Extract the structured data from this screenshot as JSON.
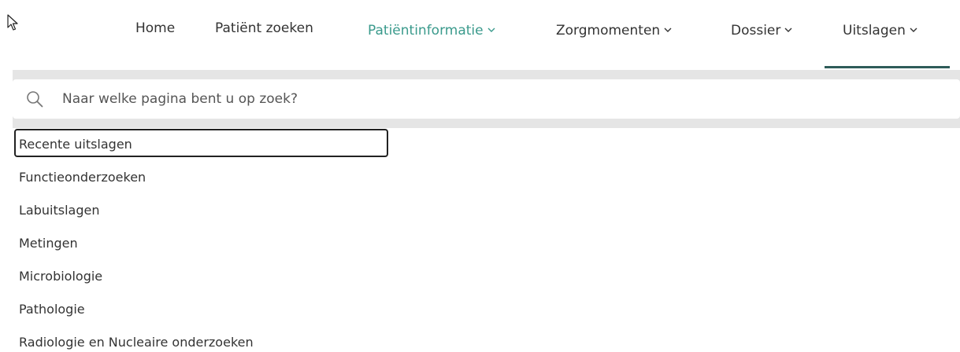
{
  "nav": {
    "items": [
      {
        "label": "Home",
        "chevron": ""
      },
      {
        "label": "Patiënt zoeken",
        "chevron": ""
      },
      {
        "label": "Patiëntinformatie",
        "chevron": "⌄",
        "highlight": true
      },
      {
        "label": "Zorgmomenten",
        "chevron": "⌄"
      },
      {
        "label": "Dossier",
        "chevron": "⌄"
      },
      {
        "label": "Uitslagen",
        "chevron": "⌄",
        "active": true
      }
    ]
  },
  "search": {
    "placeholder": "Naar welke pagina bent u op zoek?",
    "value": ""
  },
  "results": {
    "focused_index": 0,
    "items": [
      "Recente uitslagen",
      "Functieonderzoeken",
      "Labuitslagen",
      "Metingen",
      "Microbiologie",
      "Pathologie",
      "Radiologie en Nucleaire onderzoeken"
    ]
  },
  "colors": {
    "highlight": "#3a9a8c",
    "active_underline": "#2e5c59",
    "panel": "#e5e5e5"
  },
  "icons": {
    "cursor": "mouse-pointer-icon",
    "search": "search-icon",
    "chevron": "chevron-down-icon"
  }
}
